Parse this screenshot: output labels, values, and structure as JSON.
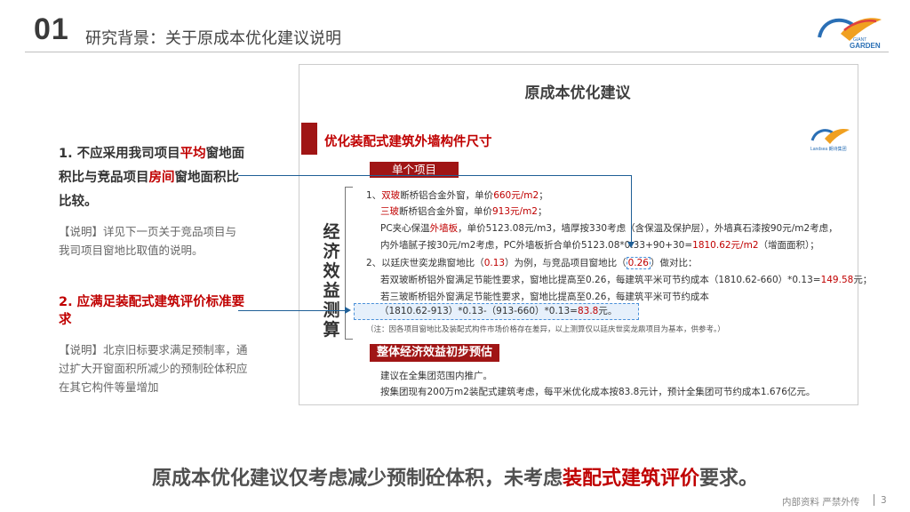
{
  "header": {
    "number": "01",
    "title": "研究背景：关于原成本优化建议说明",
    "logo_text": "GARDEN",
    "logo_small": "GIANT"
  },
  "left": {
    "point1": {
      "prefix": "1. 不应采用我司项目",
      "hl1": "平均",
      "mid1": "窗地面积比与竞品项目",
      "hl2": "房间",
      "suffix": "窗地面积比比较。"
    },
    "note1": "【说明】详见下一页关于竞品项目与我司项目窗地比取值的说明。",
    "point2": "2. 应满足装配式建筑评价标准要求",
    "note2": "【说明】北京旧标要求满足预制率，通过扩大开窗面积所减少的预制砼体积应在其它构件等量增加"
  },
  "panel": {
    "title": "原成本优化建议",
    "subtitle": "优化装配式建筑外墙构件尺寸",
    "mini_logo_text": "Landsea 朗诗集团",
    "vertical_title": "经济效益测算",
    "tag_single": "单个项目",
    "tag_overall": "整体经济效益初步预估",
    "line1": {
      "a": "1、",
      "b": "双玻",
      "c": "断桥铝合金外窗，单价",
      "d": "660元/m2",
      "e": "；"
    },
    "line2": {
      "a": "三玻",
      "b": "断桥铝合金外窗，单价",
      "c": "913元/m2",
      "d": "；"
    },
    "line3": {
      "a": "PC夹心保温",
      "b": "外墙板",
      "c": "，单价5123.08元/m3，墙厚按330考虑（含保温及保护层），外墙真石漆按90元/m2考虑，"
    },
    "line4": {
      "a": "内外墙腻子按30元/m2考虑，PC外墙板折合单价5123.08*0.33+90+30=",
      "b": "1810.62元/m2",
      "c": "（增面面积）；"
    },
    "line5": {
      "a": "2、以廷庆世奕龙鼎窗地比（",
      "b": "0.13",
      "c": "）为例，与竞品项目窗地比（",
      "d": "0.26",
      "e": "）做对比："
    },
    "line6": {
      "a": "若双玻断桥铝外窗满足节能性要求，窗地比提高至0.26，每建筑平米可节约成本（1810.62-660）*0.13=",
      "b": "149.58",
      "c": "元；"
    },
    "line7": "若三玻断桥铝外窗满足节能性要求，窗地比提高至0.26，每建筑平米可节约成本",
    "line8": {
      "a": "（1810.62-913）*0.13-（913-660）*0.13=",
      "b": "83.8",
      "c": "元。"
    },
    "note": "（注：因各项目窗地比及装配式构件市场价格存在差异，以上测算仅以廷庆世奕龙鼎项目为基本，供参考。）",
    "overall1": "建议在全集团范围内推广。",
    "overall2": "按集团现有200万m2装配式建筑考虑，每平米优化成本按83.8元计，预计全集团可节约成本1.676亿元。"
  },
  "conclusion": {
    "a": "原成本优化建议仅考虑减少预制砼体积，未考虑",
    "b": "装配式建筑评价",
    "c": "要求。"
  },
  "footer": {
    "text": "内部资料 严禁外传",
    "page": "3"
  },
  "colors": {
    "accent_red": "#c00000",
    "tag_red": "#a01515",
    "connector_blue": "#1f5f96",
    "box_blue": "#4a90d9"
  }
}
